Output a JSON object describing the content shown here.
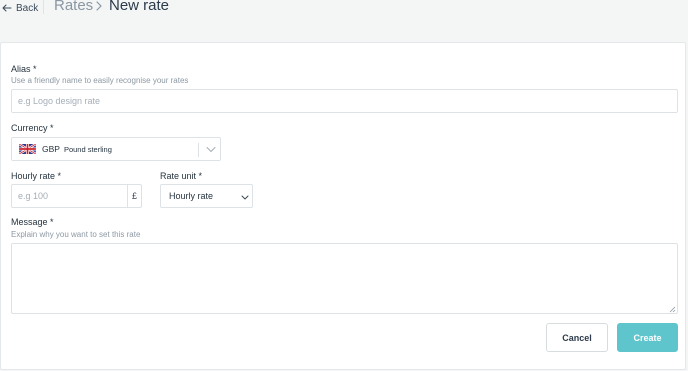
{
  "header": {
    "back_label": "Back",
    "breadcrumb_parent": "Rates",
    "page_title": "New rate"
  },
  "form": {
    "alias": {
      "label": "Alias *",
      "hint": "Use a friendly name to easily recognise your rates",
      "placeholder": "e.g Logo design rate",
      "value": ""
    },
    "currency": {
      "label": "Currency *",
      "code": "GBP",
      "name": "Pound sterling",
      "flag_icon": "uk-flag-icon"
    },
    "hourly_rate": {
      "label": "Hourly rate *",
      "placeholder": "e.g 100",
      "value": "",
      "suffix": "£"
    },
    "rate_unit": {
      "label": "Rate unit *",
      "selected": "Hourly rate"
    },
    "message": {
      "label": "Message *",
      "hint": "Explain why you want to set this rate",
      "value": ""
    }
  },
  "actions": {
    "cancel_label": "Cancel",
    "create_label": "Create"
  },
  "colors": {
    "accent": "#5ec5cc",
    "page_bg": "#f4f6f6",
    "border": "#dde2e6"
  }
}
